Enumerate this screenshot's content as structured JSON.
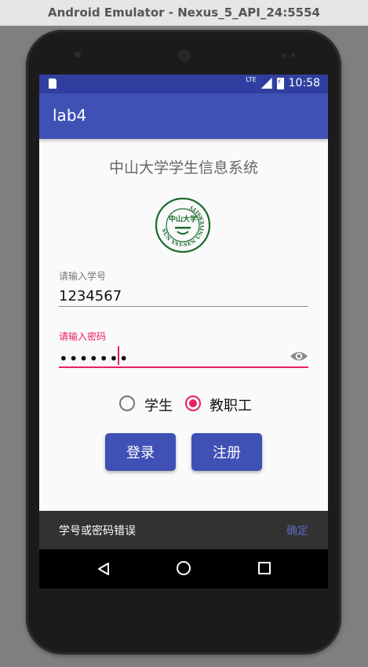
{
  "window": {
    "title": "Android Emulator - Nexus_5_API_24:5554"
  },
  "status_bar": {
    "time": "10:58",
    "network": "LTE",
    "icons": [
      "sd-card-icon",
      "signal-icon",
      "battery-charging-icon"
    ]
  },
  "app_bar": {
    "title": "lab4"
  },
  "main": {
    "title": "中山大学学生信息系统",
    "logo": {
      "text": "中山大学",
      "ring_text": "SUN YAT-SEN UNIVERSITY",
      "color": "#1b6b2f"
    },
    "student_id": {
      "label": "请输入学号",
      "value": "1234567"
    },
    "password": {
      "label": "请输入密码",
      "masked_value": "•••••••"
    },
    "roles": [
      {
        "label": "学生",
        "selected": false
      },
      {
        "label": "教职工",
        "selected": true
      }
    ],
    "buttons": {
      "login": "登录",
      "register": "注册"
    }
  },
  "snackbar": {
    "message": "学号或密码错误",
    "action": "确定"
  },
  "colors": {
    "primary": "#3f51b5",
    "primary_dark": "#303f9f",
    "accent": "#e91e63",
    "snackbar_action": "#5c6bc0"
  }
}
